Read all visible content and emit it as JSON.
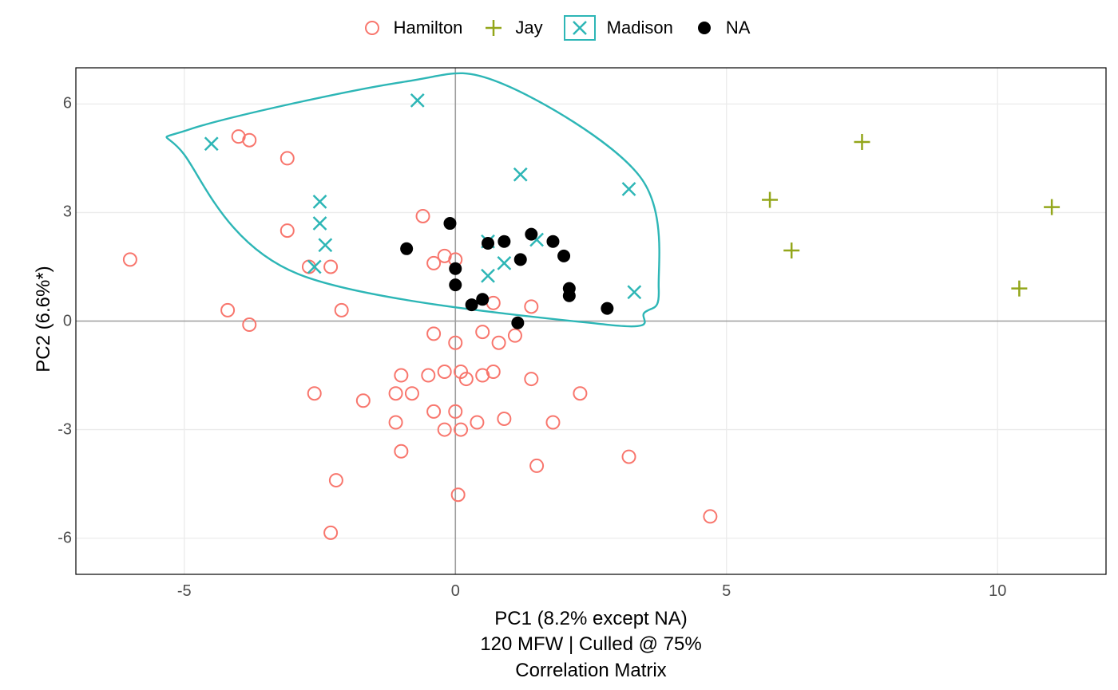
{
  "chart_data": {
    "type": "scatter",
    "xlabel": "PC1 (8.2% except NA)",
    "ylabel": "PC2 (6.6%*)",
    "subtitle1": "120 MFW | Culled @ 75%",
    "subtitle2": "Correlation Matrix",
    "xlim": [
      -7,
      12
    ],
    "ylim": [
      -7,
      7
    ],
    "x_ticks": [
      -5,
      0,
      5,
      10
    ],
    "y_ticks": [
      -6,
      -3,
      0,
      3,
      6
    ],
    "legend": [
      {
        "name": "Hamilton",
        "shape": "circle-open",
        "color": "#f8766d"
      },
      {
        "name": "Jay",
        "shape": "plus",
        "color": "#93a61a"
      },
      {
        "name": "Madison",
        "shape": "cross",
        "color": "#2db6b6",
        "boxed": true
      },
      {
        "name": "NA",
        "shape": "circle-solid",
        "color": "#000000"
      }
    ],
    "series": [
      {
        "name": "Hamilton",
        "shape": "circle-open",
        "color": "#f8766d",
        "points": [
          [
            -6.0,
            1.7
          ],
          [
            -4.2,
            0.3
          ],
          [
            -4.0,
            5.1
          ],
          [
            -3.8,
            5.0
          ],
          [
            -3.8,
            -0.1
          ],
          [
            -3.1,
            2.5
          ],
          [
            -3.1,
            4.5
          ],
          [
            -2.7,
            1.5
          ],
          [
            -2.6,
            -2.0
          ],
          [
            -2.3,
            1.5
          ],
          [
            -2.2,
            -4.4
          ],
          [
            -2.3,
            -5.85
          ],
          [
            -2.1,
            0.3
          ],
          [
            -1.7,
            -2.2
          ],
          [
            -1.1,
            -2.8
          ],
          [
            -1.1,
            -2.0
          ],
          [
            -1.0,
            -1.5
          ],
          [
            -1.0,
            -3.6
          ],
          [
            -0.8,
            -2.0
          ],
          [
            -0.6,
            2.9
          ],
          [
            -0.5,
            -1.5
          ],
          [
            -0.4,
            1.6
          ],
          [
            -0.4,
            -2.5
          ],
          [
            -0.2,
            1.8
          ],
          [
            -0.2,
            -1.4
          ],
          [
            -0.4,
            -0.35
          ],
          [
            0.0,
            1.7
          ],
          [
            0.0,
            -2.5
          ],
          [
            0.0,
            -0.6
          ],
          [
            -0.2,
            -3.0
          ],
          [
            0.1,
            -1.4
          ],
          [
            0.1,
            -3.0
          ],
          [
            0.2,
            -1.6
          ],
          [
            0.05,
            -4.8
          ],
          [
            0.4,
            -2.8
          ],
          [
            0.5,
            -0.3
          ],
          [
            0.5,
            -1.5
          ],
          [
            0.7,
            -1.4
          ],
          [
            0.7,
            0.5
          ],
          [
            0.8,
            -0.6
          ],
          [
            0.9,
            -2.7
          ],
          [
            1.1,
            -0.4
          ],
          [
            1.4,
            0.4
          ],
          [
            1.4,
            -1.6
          ],
          [
            1.5,
            -4.0
          ],
          [
            1.8,
            -2.8
          ],
          [
            2.3,
            -2.0
          ],
          [
            3.2,
            -3.75
          ],
          [
            4.7,
            -5.4
          ]
        ]
      },
      {
        "name": "Jay",
        "shape": "plus",
        "color": "#93a61a",
        "points": [
          [
            5.8,
            3.35
          ],
          [
            6.2,
            1.95
          ],
          [
            7.5,
            4.95
          ],
          [
            10.4,
            0.9
          ],
          [
            11.0,
            3.15
          ]
        ]
      },
      {
        "name": "Madison",
        "shape": "cross",
        "color": "#2db6b6",
        "points": [
          [
            -4.5,
            4.9
          ],
          [
            -2.5,
            3.3
          ],
          [
            -2.5,
            2.7
          ],
          [
            -2.4,
            2.1
          ],
          [
            -2.6,
            1.5
          ],
          [
            -0.7,
            6.1
          ],
          [
            0.6,
            2.2
          ],
          [
            0.6,
            1.25
          ],
          [
            0.9,
            1.6
          ],
          [
            1.2,
            4.05
          ],
          [
            1.5,
            2.25
          ],
          [
            3.2,
            3.65
          ],
          [
            3.3,
            0.8
          ]
        ]
      },
      {
        "name": "NA",
        "shape": "circle-solid",
        "color": "#000000",
        "points": [
          [
            -0.9,
            2.0
          ],
          [
            -0.1,
            2.7
          ],
          [
            0.0,
            1.45
          ],
          [
            0.0,
            1.0
          ],
          [
            0.3,
            0.45
          ],
          [
            0.5,
            0.6
          ],
          [
            0.6,
            2.15
          ],
          [
            0.9,
            2.2
          ],
          [
            1.15,
            -0.05
          ],
          [
            1.2,
            1.7
          ],
          [
            1.4,
            2.4
          ],
          [
            1.8,
            2.2
          ],
          [
            2.0,
            1.8
          ],
          [
            2.1,
            0.9
          ],
          [
            2.1,
            0.7
          ],
          [
            2.8,
            0.35
          ]
        ]
      }
    ],
    "hull_outline": {
      "color": "#2db6b6",
      "points": [
        [
          -4.9,
          5.3
        ],
        [
          -1.0,
          6.6
        ],
        [
          0.8,
          6.6
        ],
        [
          3.4,
          4.0
        ],
        [
          3.75,
          0.9
        ],
        [
          3.5,
          0.25
        ],
        [
          2.8,
          -0.1
        ],
        [
          -2.9,
          1.3
        ],
        [
          -5.0,
          4.6
        ]
      ]
    }
  }
}
